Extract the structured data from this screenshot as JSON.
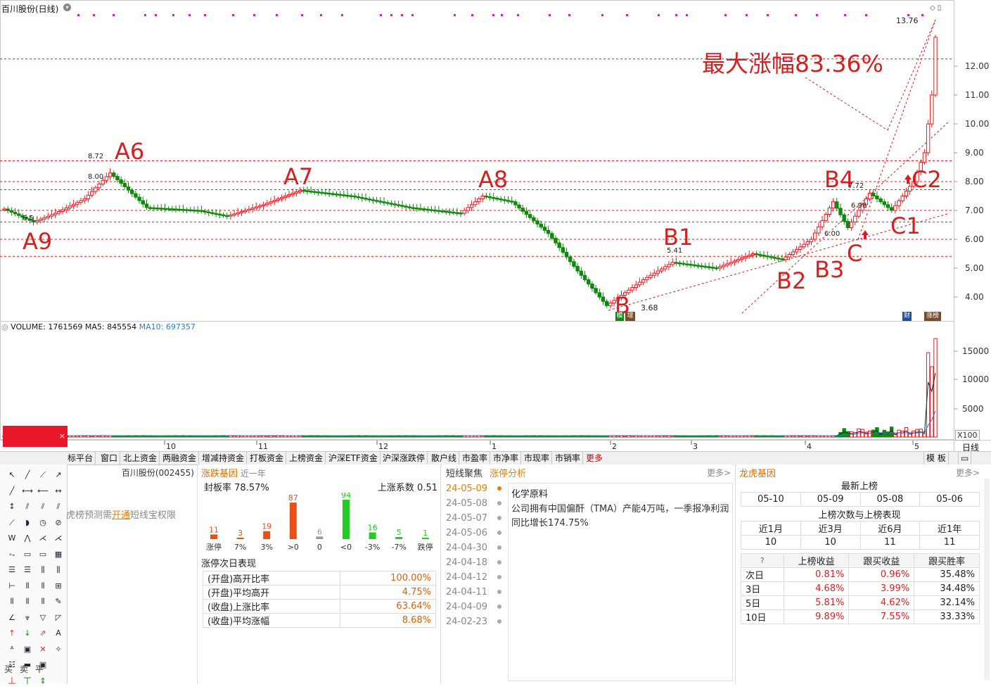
{
  "chart": {
    "title": "百川股份(日线)",
    "high_label": "13.76",
    "low_label": "3.68",
    "gain_annotation": "最大涨幅83.36%",
    "price_ticks": [
      "12.00",
      "11.00",
      "10.00",
      "9.00",
      "8.00",
      "7.00",
      "6.00",
      "5.00",
      "4.00"
    ],
    "point_labels": [
      "A6",
      "A7",
      "A8",
      "A9",
      "B",
      "B1",
      "B2",
      "B3",
      "B4",
      "C",
      "C1",
      "C2"
    ],
    "small_labels": [
      "8.72",
      "8.00",
      "6.5",
      "5.41",
      "6.00",
      "6.98",
      "7.72"
    ],
    "badges": [
      "模",
      "增",
      "财",
      "涨榜"
    ],
    "volume_header": {
      "label": "VOLUME:",
      "volume": "1761569",
      "ma5_label": "MA5:",
      "ma5": "845554",
      "ma10_label": "MA10:",
      "ma10": "697357"
    },
    "volume_ticks": [
      "15000",
      "10000",
      "5000"
    ],
    "volume_unit": "X100",
    "date_labels": [
      "10",
      "11",
      "12",
      "1",
      "2",
      "3",
      "4",
      "5"
    ],
    "period_label": "日线",
    "colors": {
      "up": "#e8181a",
      "down": "#0d8a0d",
      "grid": "#d62020",
      "ma5": "#222222",
      "ma10": "#2a7fd4"
    }
  },
  "tabs": [
    "标平台",
    "窗口",
    "北上资金",
    "两融资金",
    "增减持资金",
    "打板资金",
    "上榜资金",
    "沪深ETF资金",
    "沪深涨跌停",
    "散户线",
    "市盈率",
    "市净率",
    "市现率",
    "市销率",
    "更多"
  ],
  "tab_right": {
    "templates": "模 板",
    "window_icon": "window-icon"
  },
  "toolbox": {
    "stock_name": "百川股份(002455)",
    "promo_text_a": "虎榜预测需",
    "promo_link": "开通",
    "promo_text_b": "短线宝权限",
    "bottom": [
      "买",
      "卖",
      "平"
    ]
  },
  "zhangdie": {
    "title": "涨跌基因",
    "period": "近一年",
    "seal_rate_label": "封板率",
    "seal_rate": "78.57%",
    "coef_label": "上涨系数",
    "coef": "0.51",
    "bars": [
      {
        "label": "涨停",
        "value": 11,
        "color": "#e8501a"
      },
      {
        "label": "7%",
        "value": 3,
        "color": "#e8501a"
      },
      {
        "label": "3%",
        "value": 19,
        "color": "#e8501a"
      },
      {
        "label": ">0",
        "value": 87,
        "color": "#e8501a"
      },
      {
        "label": "0",
        "value": 6,
        "color": "#999999"
      },
      {
        "label": "<0",
        "value": 94,
        "color": "#22cc22"
      },
      {
        "label": "-3%",
        "value": 16,
        "color": "#22cc22"
      },
      {
        "label": "-7%",
        "value": 5,
        "color": "#22cc22"
      },
      {
        "label": "跌停",
        "value": 1,
        "color": "#22cc22"
      }
    ],
    "next_day_title": "涨停次日表现",
    "next_day": [
      {
        "label": "(开盘)高开比率",
        "value": "100.00%"
      },
      {
        "label": "(开盘)平均高开",
        "value": "4.75%"
      },
      {
        "label": "(收盘)上涨比率",
        "value": "63.64%"
      },
      {
        "label": "(收盘)平均涨幅",
        "value": "8.68%"
      }
    ]
  },
  "news": {
    "tab1": "短线聚焦",
    "tab2": "涨停分析",
    "more": "更多>",
    "dates": [
      "24-05-09",
      "24-05-08",
      "24-05-07",
      "24-05-06",
      "24-04-30",
      "24-04-18",
      "24-04-12",
      "24-04-11",
      "24-04-09",
      "24-02-23"
    ],
    "headline": "化学原料",
    "body": "公司拥有中国偏酐（TMA）产能4万吨，一季报净利润同比增长174.75%"
  },
  "lhb": {
    "title": "龙虎基因",
    "more": "更多>",
    "latest_title": "最新上榜",
    "latest_dates": [
      "05-10",
      "05-09",
      "05-08",
      "05-06"
    ],
    "count_title": "上榜次数与上榜表现",
    "periods": [
      "近1月",
      "近3月",
      "近6月",
      "近1年"
    ],
    "counts": [
      "10",
      "10",
      "11",
      "11"
    ],
    "head": [
      "?",
      "上榜收益",
      "跟买收益",
      "跟买胜率"
    ],
    "rows": [
      {
        "label": "次日",
        "a": "0.81%",
        "b": "0.96%",
        "c": "35.48%"
      },
      {
        "label": "3日",
        "a": "4.68%",
        "b": "3.99%",
        "c": "34.48%"
      },
      {
        "label": "5日",
        "a": "5.81%",
        "b": "4.62%",
        "c": "32.14%"
      },
      {
        "label": "10日",
        "a": "9.89%",
        "b": "7.55%",
        "c": "33.33%"
      }
    ]
  }
}
